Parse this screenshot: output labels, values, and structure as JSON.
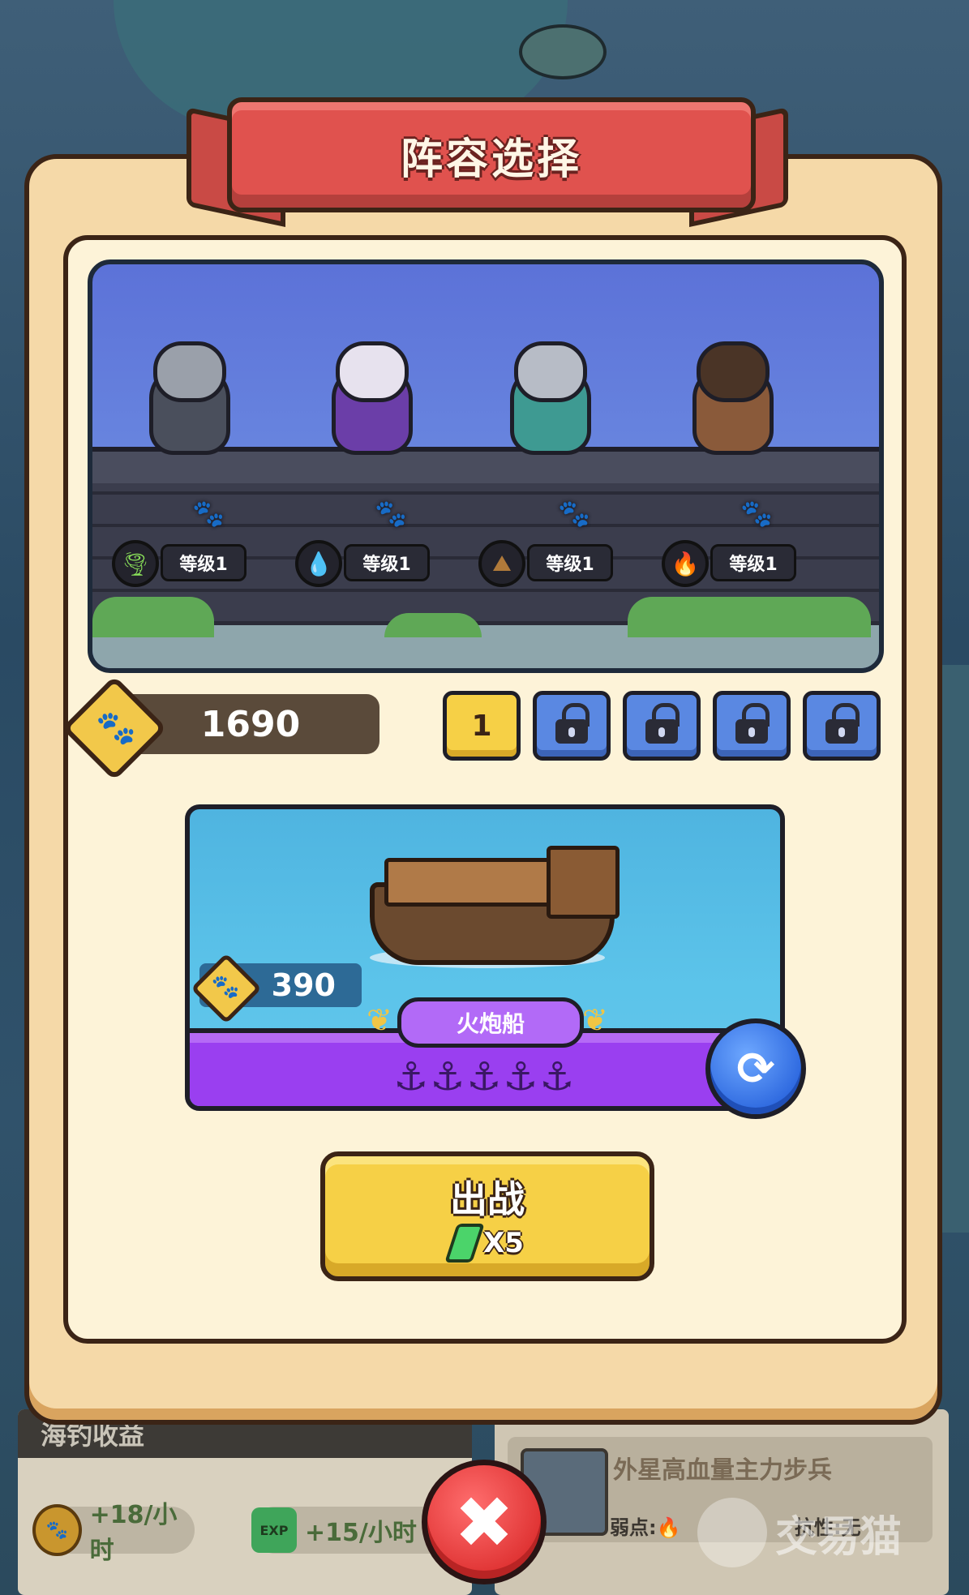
{
  "title": "阵容选择",
  "heroes": [
    {
      "element_icon": "wind-icon",
      "level": "等级1"
    },
    {
      "element_icon": "water-drop-icon",
      "level": "等级1"
    },
    {
      "element_icon": "earth-icon",
      "level": "等级1"
    },
    {
      "element_icon": "fire-icon",
      "level": "等级1"
    }
  ],
  "currency": {
    "amount": "1690",
    "icon": "paw-coin-icon"
  },
  "slots": [
    {
      "label": "1",
      "state": "active"
    },
    {
      "state": "locked"
    },
    {
      "state": "locked"
    },
    {
      "state": "locked"
    },
    {
      "state": "locked"
    }
  ],
  "ship": {
    "name": "火炮船",
    "price": "390",
    "anchors": "⚓⚓⚓⚓⚓",
    "anchor_count": 5
  },
  "battle_button": {
    "label": "出战",
    "cost": "X5"
  },
  "background_ui": {
    "income_title": "海钓收益",
    "income_coin": "+18/小时",
    "income_exp": "+15/小时",
    "exp_badge": "EXP",
    "enemy_name": "外星高血量主力步兵",
    "enemy_weakness": "弱点:",
    "enemy_resist": "抗性:无"
  },
  "watermark": "交易猫",
  "colors": {
    "frame": "#f5d9a8",
    "ribbon": "#e0524e",
    "scene_sky": "#6a88e0",
    "slot_active": "#f6d046",
    "slot_locked": "#5a88e2",
    "ship_bar": "#9a3ff0",
    "battle_button": "#f6d046",
    "close_button": "#e03434"
  }
}
